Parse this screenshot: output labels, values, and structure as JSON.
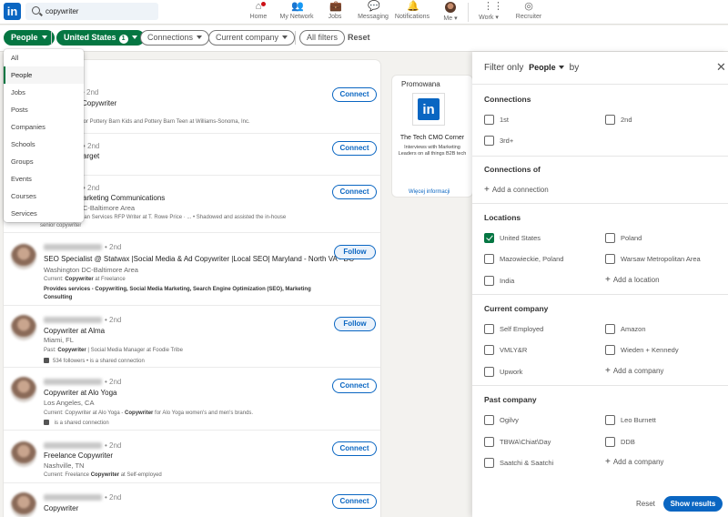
{
  "nav": {
    "search_value": "copywriter",
    "items": [
      {
        "label": "Home",
        "icon": "home-icon"
      },
      {
        "label": "My Network",
        "icon": "network-icon"
      },
      {
        "label": "Jobs",
        "icon": "jobs-icon"
      },
      {
        "label": "Messaging",
        "icon": "messaging-icon"
      },
      {
        "label": "Notifications",
        "icon": "bell-icon"
      },
      {
        "label": "Me",
        "icon": "avatar"
      },
      {
        "label": "Work",
        "icon": "grid-icon"
      },
      {
        "label": "Recruiter",
        "icon": "compass-icon"
      }
    ]
  },
  "filters": {
    "people": "People",
    "location": "United States",
    "location_count": "1",
    "connections": "Connections",
    "current_company": "Current company",
    "all_filters": "All filters",
    "reset": "Reset"
  },
  "dropdown": {
    "items": [
      "All",
      "People",
      "Jobs",
      "Posts",
      "Companies",
      "Schools",
      "Groups",
      "Events",
      "Courses",
      "Services"
    ],
    "selected": "People"
  },
  "results": [
    {
      "degree": "• 2nd",
      "title": "Copywriter",
      "location": "",
      "extra": "for Pottery Barn Kids and Pottery Barn Teen at Williams-Sonoma, Inc.",
      "button": "Connect"
    },
    {
      "degree": "• 2nd",
      "title": "arget",
      "location": "",
      "extra": "",
      "button": "Connect"
    },
    {
      "degree": "• 2nd",
      "title": "arketing Communications",
      "location": "C-Baltimore Area",
      "extra": "lan Services RFP Writer at T. Rowe Price · ... • Shadowed and assisted the in-house",
      "extra2": "senior copywriter",
      "button": "Connect"
    },
    {
      "degree": "• 2nd",
      "title": "SEO Specialist @ Statwax |Social Media & Ad Copywriter |Local SEO| Maryland - North VA - DC",
      "location": "Washington DC-Baltimore Area",
      "extra_pre": "Current: ",
      "extra_bold": "Copywriter",
      "extra_post": " at Freelance",
      "extra2_pre": "Provides services - Copywriting, Social Media Marketing, Search Engine Optimization (SEO), Marketing",
      "extra3": "Consulting",
      "button": "Follow"
    },
    {
      "degree": "• 2nd",
      "title": "Copywriter at Alma",
      "location": "Miami, FL",
      "extra_pre": "Past: ",
      "extra_bold": "Copywriter",
      "extra_post": " | Social Media Manager at Foodie Tribe",
      "shared": "534 followers •                          is a shared connection",
      "button": "Follow"
    },
    {
      "degree": "• 2nd",
      "title": "Copywriter at Alo Yoga",
      "location": "Los Angeles, CA",
      "extra_pre": "Current: Copywriter at Alo Yoga - ",
      "extra_bold": "Copywriter",
      "extra_post": " for Alo Yoga women's and men's brands.",
      "shared": "                       is a shared connection",
      "button": "Connect"
    },
    {
      "degree": "• 2nd",
      "title": "Freelance Copywriter",
      "location": "Nashville, TN",
      "extra_pre": "Current: Freelance ",
      "extra_bold": "Copywriter",
      "extra_post": " at Self-employed",
      "button": "Connect"
    },
    {
      "degree": "• 2nd",
      "title": "Copywriter",
      "location": "",
      "button": "Connect"
    }
  ],
  "ad": {
    "label": "Promowana",
    "title": "The Tech CMO Corner",
    "desc": "Interviews with Marketing Leaders on all things B2B tech",
    "link": "Więcej informacji"
  },
  "panel": {
    "head_pre": "Filter only",
    "head_sel": "People",
    "head_post": "by",
    "sections": {
      "connections": {
        "title": "Connections",
        "options": [
          "1st",
          "2nd",
          "3rd+"
        ]
      },
      "connections_of": {
        "title": "Connections of",
        "add": "Add a connection"
      },
      "locations": {
        "title": "Locations",
        "options": [
          "United States",
          "Poland",
          "Mazowieckie, Poland",
          "Warsaw Metropolitan Area",
          "India"
        ],
        "add": "Add a location"
      },
      "current_company": {
        "title": "Current company",
        "options": [
          "Self Employed",
          "Amazon",
          "VMLY&R",
          "Wieden + Kennedy",
          "Upwork"
        ],
        "add": "Add a company"
      },
      "past_company": {
        "title": "Past company",
        "options": [
          "Ogilvy",
          "Leo Burnett",
          "TBWA\\Chiat\\Day",
          "DDB",
          "Saatchi & Saatchi"
        ],
        "add": "Add a company"
      }
    },
    "reset": "Reset",
    "show": "Show results"
  }
}
